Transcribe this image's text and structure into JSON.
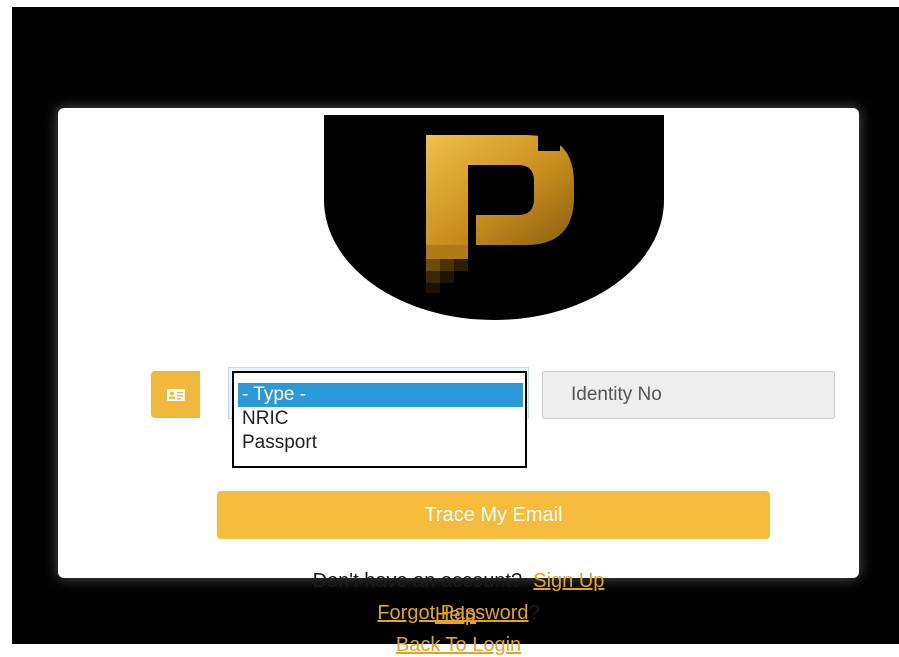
{
  "logo": {
    "icon": "p-logo-icon",
    "accent": "#d9a02a"
  },
  "identity": {
    "type_options": [
      "- Type -",
      "NRIC",
      "Passport"
    ],
    "selected_index": 0,
    "identity_placeholder": "Identity No",
    "id_card_icon": "id-card-icon"
  },
  "actions": {
    "trace_label": "Trace My Email"
  },
  "links": {
    "no_account_text": "Don't have an account?",
    "sign_up": "Sign Up",
    "forgot_password": "Forgot Password",
    "forgot_suffix": "?",
    "back_to_login": "Back To Login",
    "help": "Help"
  },
  "colors": {
    "button": "#f5bc3e",
    "link": "#e0a526",
    "selected_option": "#2b9ad8",
    "background": "#000000"
  }
}
